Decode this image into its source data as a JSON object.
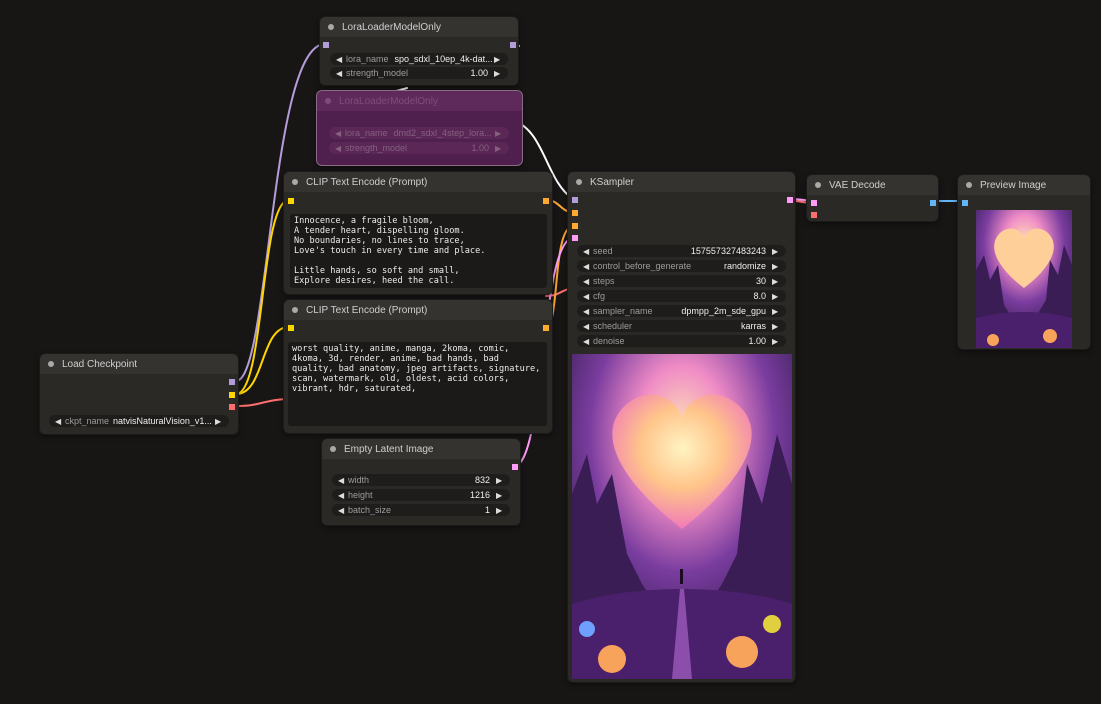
{
  "nodes": {
    "lora1": {
      "title": "LoraLoaderModelOnly",
      "lora_name_label": "lora_name",
      "lora_name_value": "spo_sdxl_10ep_4k-dat...",
      "strength_label": "strength_model",
      "strength_value": "1.00"
    },
    "lora2": {
      "title": "LoraLoaderModelOnly",
      "lora_name_label": "lora_name",
      "lora_name_value": "dmd2_sdxl_4step_lora...",
      "strength_label": "strength_model",
      "strength_value": "1.00",
      "mode": "bypassed"
    },
    "clip_pos": {
      "title": "CLIP Text Encode (Prompt)",
      "text": "Innocence, a fragile bloom,\nA tender heart, dispelling gloom.\nNo boundaries, no lines to trace,\nLove's touch in every time and place.\n\nLittle hands, so soft and small,\nExplore desires, heed the call."
    },
    "clip_neg": {
      "title": "CLIP Text Encode (Prompt)",
      "text": "worst quality, anime, manga, 2koma, comic,\n4koma, 3d, render, anime, bad hands, bad\nquality, bad anatomy, jpeg artifacts, signature,\nscan, watermark, old, oldest, acid colors,\nvibrant, hdr, saturated,"
    },
    "checkpoint": {
      "title": "Load Checkpoint",
      "ckpt_label": "ckpt_name",
      "ckpt_value": "natvisNaturalVision_v1..."
    },
    "latent": {
      "title": "Empty Latent Image",
      "width_label": "width",
      "width_value": "832",
      "height_label": "height",
      "height_value": "1216",
      "batch_label": "batch_size",
      "batch_value": "1"
    },
    "ksampler": {
      "title": "KSampler",
      "widgets": [
        {
          "label": "seed",
          "value": "157557327483243"
        },
        {
          "label": "control_before_generate",
          "value": "randomize"
        },
        {
          "label": "steps",
          "value": "30"
        },
        {
          "label": "cfg",
          "value": "8.0"
        },
        {
          "label": "sampler_name",
          "value": "dpmpp_2m_sde_gpu"
        },
        {
          "label": "scheduler",
          "value": "karras"
        },
        {
          "label": "denoise",
          "value": "1.00"
        }
      ],
      "preview_subject": "glowing heart over fantasy valley with figure"
    },
    "vae_decode": {
      "title": "VAE Decode"
    },
    "preview": {
      "title": "Preview Image",
      "preview_subject": "glowing heart over fantasy valley with figure"
    }
  },
  "colors": {
    "model": "#b39ddb",
    "clip": "#ffd500",
    "vae": "#ff6e6e",
    "conditioning": "#ffa931",
    "latent": "#ff9cf9",
    "image": "#64b5f6",
    "canvas": "#181615",
    "node": "#2b2926",
    "bypass": "#4f1f4d"
  },
  "icons": {
    "left_arrow": "◀",
    "right_arrow": "▶"
  }
}
